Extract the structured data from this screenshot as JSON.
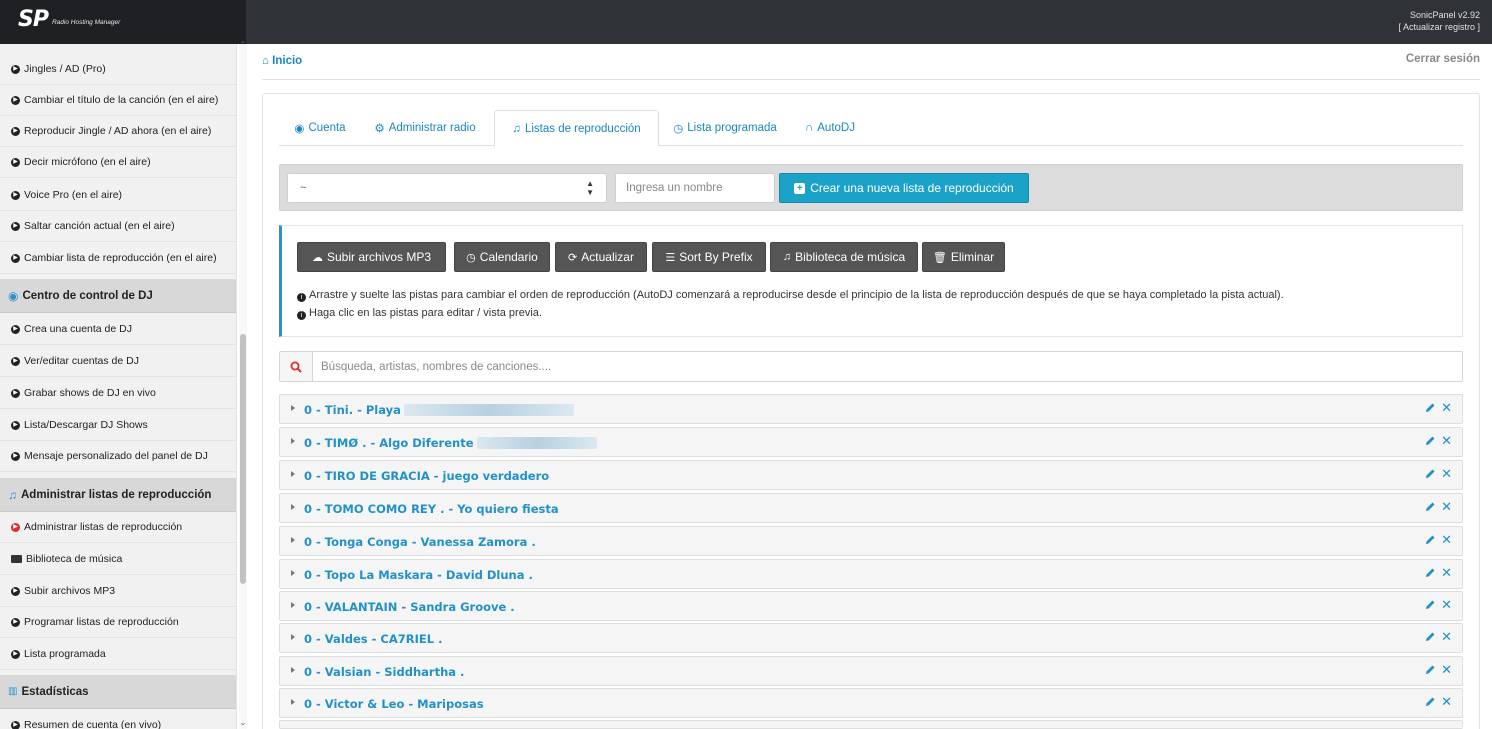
{
  "header": {
    "logo_mark": "SP",
    "logo_sub": "Radio Hosting Manager",
    "version": "SonicPanel v2.92",
    "update_link": "[ Actualizar registro ]"
  },
  "breadcrumb": "Inicio",
  "logout": "Cerrar sesión",
  "sidebar": {
    "items_top": [
      "Jingles / AD (Pro)",
      "Cambiar el título de la canción (en el aire)",
      "Reproducir Jingle / AD ahora (en el aire)",
      "Decir micrófono (en el aire)",
      "Voice Pro (en el aire)",
      "Saltar canción actual (en el aire)",
      "Cambiar lista de reproducción (en el aire)"
    ],
    "dj_header": "Centro de control de DJ",
    "dj_items": [
      "Crea una cuenta de DJ",
      "Ver/editar cuentas de DJ",
      "Grabar shows de DJ en vivo",
      "Lista/Descargar DJ Shows",
      "Mensaje personalizado del panel de DJ"
    ],
    "playlist_header": "Administrar listas de reproducción",
    "playlist_items": [
      "Administrar listas de reproducción",
      "Biblioteca de música",
      "Subir archivos MP3",
      "Programar listas de reproducción",
      "Lista programada"
    ],
    "stats_header": "Estadísticas",
    "stats_items": [
      "Resumen de cuenta (en vivo)"
    ]
  },
  "tabs": [
    {
      "label": "Cuenta",
      "icon": "user-circle-icon"
    },
    {
      "label": "Administrar radio",
      "icon": "gear-icon"
    },
    {
      "label": "Listas de reproducción",
      "icon": "music-note-icon"
    },
    {
      "label": "Lista programada",
      "icon": "clock-icon"
    },
    {
      "label": "AutoDJ",
      "icon": "headphones-icon"
    }
  ],
  "create": {
    "select_value": "~",
    "name_placeholder": "Ingresa un nombre",
    "create_label": "Crear una nueva lista de reproducción"
  },
  "toolbar": {
    "upload": "Subir archivos MP3",
    "calendar": "Calendario",
    "refresh": "Actualizar",
    "sort": "Sort By Prefix",
    "library": "Biblioteca de música",
    "delete": "Eliminar"
  },
  "notes": {
    "drag": "Arrastre y suelte las pistas para cambiar el orden de reproducción (AutoDJ comenzará a reproducirse desde el principio de la lista de reproducción después de que se haya completado la pista actual).",
    "click": "Haga clic en las pistas para editar / vista previa."
  },
  "search_placeholder": "Búsqueda, artistas, nombres de canciones....",
  "tracks": [
    "0 - Tini. - Playa",
    "0 - TIMØ . - Algo Diferente",
    "0 - TIRO DE GRACIA - juego verdadero",
    "0 - TOMO COMO REY . - Yo quiero fiesta",
    "0 - Tonga Conga - Vanessa Zamora .",
    "0 - Topo La Maskara - David Dluna .",
    "0 - VALANTAIN - Sandra Groove .",
    "0 - Valdes - CA7RIEL .",
    "0 - Valsian - Siddhartha .",
    "0 - Victor & Leo - Mariposas"
  ],
  "colors": {
    "accent": "#2191c8",
    "create_button": "#1ba2c9",
    "toolbar_button": "#555555",
    "topbar": "#2f3237"
  }
}
